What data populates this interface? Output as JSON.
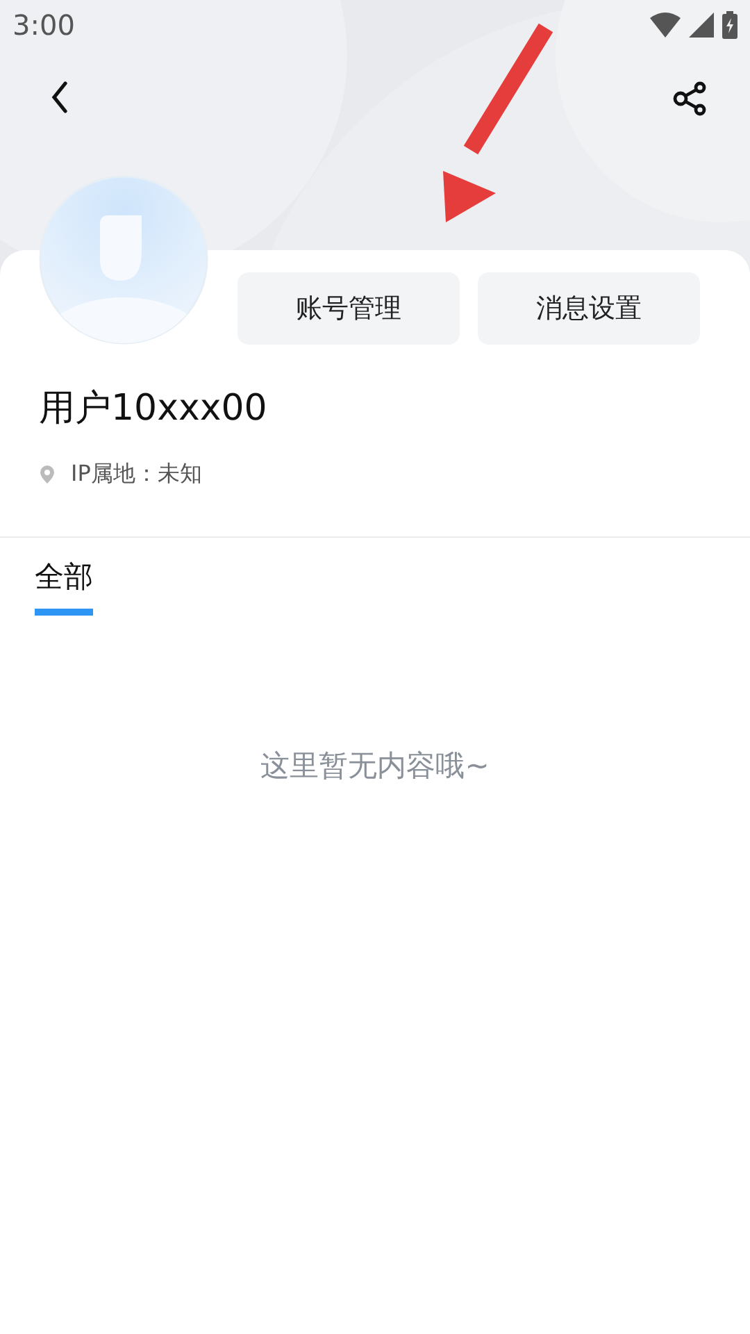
{
  "status_bar": {
    "time": "3:00"
  },
  "profile": {
    "buttons": [
      {
        "label": "账号管理"
      },
      {
        "label": "消息设置"
      }
    ],
    "username": "用户10xxx00",
    "ip_location": "IP属地：未知"
  },
  "tabs": [
    {
      "label": "全部",
      "selected": true
    }
  ],
  "empty_message": "这里暂无内容哦~"
}
